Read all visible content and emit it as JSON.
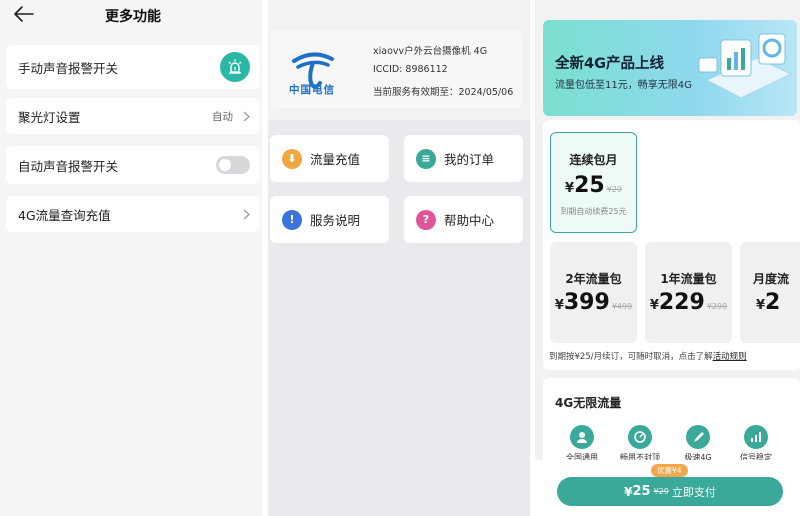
{
  "colors": {
    "accent": "#3aa99a",
    "alarm": "#2bb7a6",
    "brand_blue": "#1e6fc8"
  },
  "settings_panel": {
    "title": "更多功能",
    "back_icon": "arrow-left-icon",
    "items": [
      {
        "label": "手动声音报警开关",
        "control": "alarm-icon-button"
      },
      {
        "label": "聚光灯设置",
        "value": "自动",
        "control": "chevron-right-icon"
      },
      {
        "label": "自动声音报警开关",
        "control": "toggle",
        "toggle_on": false
      },
      {
        "label": "4G流量查询充值",
        "control": "chevron-right-icon"
      }
    ]
  },
  "service_panel": {
    "operator_logo_text": "中国电信",
    "device_name": "xiaovv户外云台摄像机 4G",
    "iccid": "ICCID: 8986112",
    "expiry": "当前服务有效期至：2024/05/06",
    "tiles": [
      {
        "label": "流量充值",
        "icon": "download-icon",
        "color": "#f0a641",
        "glyph": "⬇"
      },
      {
        "label": "我的订单",
        "icon": "order-icon",
        "color": "#3aa99a",
        "glyph": "≡"
      },
      {
        "label": "服务说明",
        "icon": "info-icon",
        "color": "#3b73d9",
        "glyph": "!"
      },
      {
        "label": "帮助中心",
        "icon": "help-icon",
        "color": "#e0559a",
        "glyph": "?"
      }
    ]
  },
  "plan_panel": {
    "banner": {
      "title": "全新4G产品上线",
      "subtitle": "流量包低至11元，畅享无限4G"
    },
    "selected_plan": {
      "name": "连续包月",
      "currency": "¥",
      "price": "25",
      "original": "¥29",
      "note": "到期自动续费25元"
    },
    "other_plans": [
      {
        "name": "2年流量包",
        "currency": "¥",
        "price": "399",
        "original": "¥499"
      },
      {
        "name": "1年流量包",
        "currency": "¥",
        "price": "229",
        "original": "¥299"
      },
      {
        "name": "月度流",
        "currency": "¥",
        "price": "2",
        "original": ""
      }
    ],
    "description": "到期按¥25/月续订，可随时取消，点击了解",
    "rules_link": "活动规则",
    "features_title": "4G无限流量",
    "features": [
      {
        "label": "全国通用",
        "icon": "user-icon"
      },
      {
        "label": "畅用不封顶",
        "icon": "gauge-icon"
      },
      {
        "label": "极速4G",
        "icon": "rocket-icon"
      },
      {
        "label": "信号稳定",
        "icon": "signal-icon"
      }
    ],
    "pay": {
      "discount_badge": "优惠¥4",
      "currency": "¥",
      "price": "25",
      "original": "¥29",
      "label": "立即支付"
    }
  }
}
